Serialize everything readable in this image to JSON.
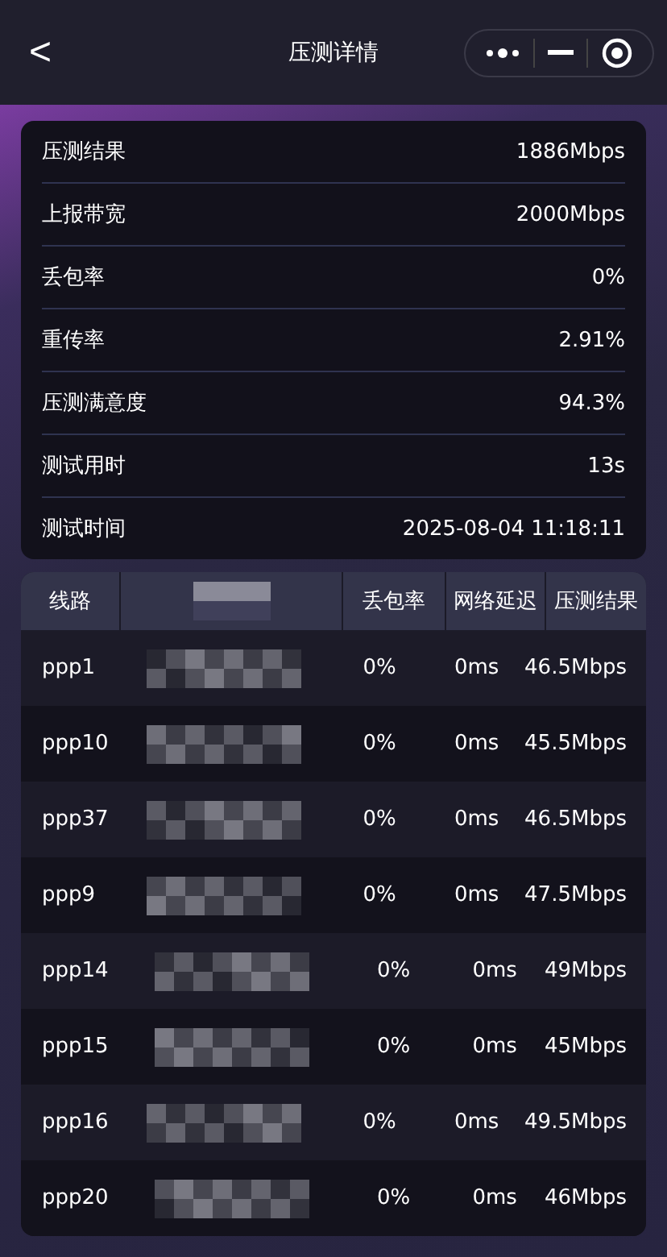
{
  "nav": {
    "back": "<",
    "title": "压测详情"
  },
  "summary": [
    {
      "label": "压测结果",
      "value": "1886Mbps"
    },
    {
      "label": "上报带宽",
      "value": "2000Mbps"
    },
    {
      "label": "丢包率",
      "value": "0%"
    },
    {
      "label": "重传率",
      "value": "2.91%"
    },
    {
      "label": "压测满意度",
      "value": "94.3%"
    },
    {
      "label": "测试用时",
      "value": "13s"
    },
    {
      "label": "测试时间",
      "value": "2025-08-04 11:18:11"
    }
  ],
  "table": {
    "columns": [
      "线路",
      "丢包率",
      "网络延迟",
      "压测结果"
    ],
    "rows": [
      {
        "line": "ppp1",
        "loss": "0%",
        "latency": "0ms",
        "result": "46.5Mbps"
      },
      {
        "line": "ppp10",
        "loss": "0%",
        "latency": "0ms",
        "result": "45.5Mbps"
      },
      {
        "line": "ppp37",
        "loss": "0%",
        "latency": "0ms",
        "result": "46.5Mbps"
      },
      {
        "line": "ppp9",
        "loss": "0%",
        "latency": "0ms",
        "result": "47.5Mbps"
      },
      {
        "line": "ppp14",
        "loss": "0%",
        "latency": "0ms",
        "result": "49Mbps"
      },
      {
        "line": "ppp15",
        "loss": "0%",
        "latency": "0ms",
        "result": "45Mbps"
      },
      {
        "line": "ppp16",
        "loss": "0%",
        "latency": "0ms",
        "result": "49.5Mbps"
      },
      {
        "line": "ppp20",
        "loss": "0%",
        "latency": "0ms",
        "result": "46Mbps"
      }
    ]
  }
}
